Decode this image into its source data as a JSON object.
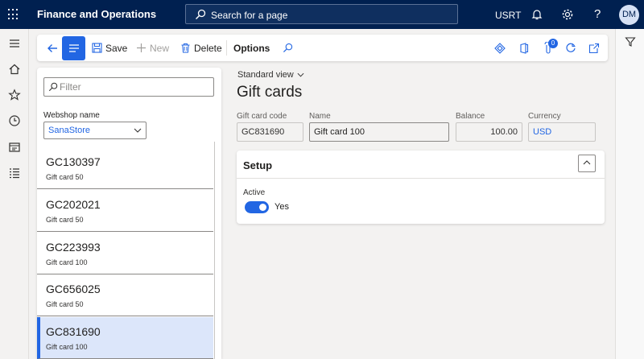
{
  "app": {
    "title": "Finance and Operations",
    "company": "USRT",
    "user_initials": "DM"
  },
  "search": {
    "placeholder": "Search for a page"
  },
  "actions": {
    "save": "Save",
    "new": "New",
    "delete": "Delete",
    "options": "Options",
    "badge_count": "0"
  },
  "list": {
    "filter_placeholder": "Filter",
    "webshop_label": "Webshop name",
    "webshop_value": "SanaStore",
    "records": [
      {
        "code": "GC130397",
        "name": "Gift card 50"
      },
      {
        "code": "GC202021",
        "name": "Gift card 50"
      },
      {
        "code": "GC223993",
        "name": "Gift card 100"
      },
      {
        "code": "GC656025",
        "name": "Gift card 50"
      },
      {
        "code": "GC831690",
        "name": "Gift card 100"
      }
    ],
    "selected_index": 4
  },
  "details": {
    "view": "Standard view",
    "title": "Gift cards",
    "fields": {
      "code_label": "Gift card code",
      "code_value": "GC831690",
      "name_label": "Name",
      "name_value": "Gift card 100",
      "balance_label": "Balance",
      "balance_value": "100.00",
      "currency_label": "Currency",
      "currency_value": "USD"
    },
    "setup": {
      "title": "Setup",
      "active_label": "Active",
      "active_value": "Yes"
    }
  },
  "colors": {
    "header": "#002050",
    "accent": "#2266e3",
    "selected_row": "#dce6fa"
  },
  "icons": [
    "waffle-icon",
    "search-icon",
    "bell-icon",
    "gear-icon",
    "help-icon",
    "hamburger-icon",
    "home-icon",
    "star-icon",
    "clock-icon",
    "workspace-icon",
    "modules-icon",
    "filter-icon"
  ]
}
